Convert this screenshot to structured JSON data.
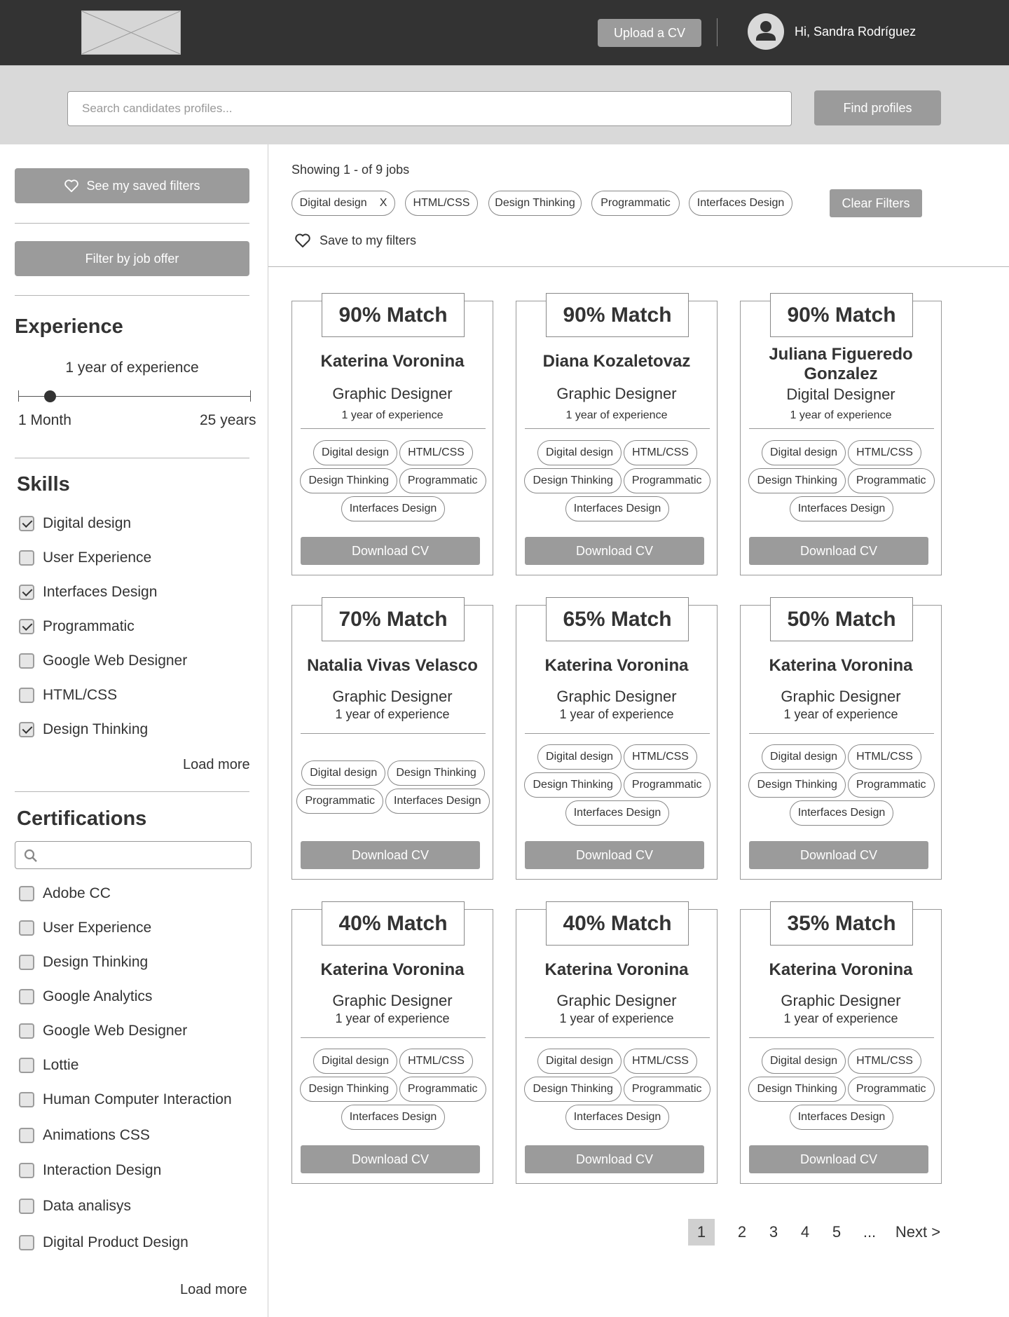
{
  "header": {
    "upload_label": "Upload a CV",
    "greeting": "Hi, Sandra Rodríguez"
  },
  "search": {
    "placeholder": "Search candidates profiles...",
    "button_label": "Find profiles"
  },
  "sidebar": {
    "saved_filters_label": "See my saved filters",
    "filter_by_job_label": "Filter by job offer",
    "experience": {
      "title": "Experience",
      "value_label": "1 year of experience",
      "min_label": "1 Month",
      "max_label": "25 years",
      "slider_value_fraction": 0.13
    },
    "skills": {
      "title": "Skills",
      "items": [
        {
          "label": "Digital design",
          "checked": true
        },
        {
          "label": "User Experience",
          "checked": false
        },
        {
          "label": "Interfaces Design",
          "checked": true
        },
        {
          "label": "Programmatic",
          "checked": true
        },
        {
          "label": "Google Web Designer",
          "checked": false
        },
        {
          "label": "HTML/CSS",
          "checked": false
        },
        {
          "label": "Design Thinking",
          "checked": true
        }
      ],
      "load_more": "Load more"
    },
    "certifications": {
      "title": "Certifications",
      "items": [
        {
          "label": "Adobe CC",
          "checked": false
        },
        {
          "label": "User Experience",
          "checked": false
        },
        {
          "label": "Design Thinking",
          "checked": false
        },
        {
          "label": "Google Analytics",
          "checked": false
        },
        {
          "label": "Google Web Designer",
          "checked": false
        },
        {
          "label": "Lottie",
          "checked": false
        },
        {
          "label": "Human Computer Interaction",
          "checked": false
        },
        {
          "label": "Animations CSS",
          "checked": false
        },
        {
          "label": "Interaction Design",
          "checked": false
        },
        {
          "label": "Data analisys",
          "checked": false
        },
        {
          "label": "Digital Product Design",
          "checked": false
        }
      ],
      "load_more": "Load more"
    }
  },
  "results": {
    "showing": "Showing 1 - of 9 jobs",
    "active_filters": [
      "Digital design",
      "HTML/CSS",
      "Design Thinking",
      "Programmatic",
      "Interfaces Design"
    ],
    "remove_filter_label": "X",
    "clear_filters_label": "Clear Filters",
    "save_filters_label": "Save to my filters"
  },
  "cards": [
    {
      "match": "90% Match",
      "name": "Katerina Voronina",
      "role": "Graphic Designer",
      "experience": "1 year of experience",
      "tags": [
        "Digital design",
        "HTML/CSS",
        "Design Thinking",
        "Programmatic",
        "Interfaces Design"
      ],
      "download": "Download CV"
    },
    {
      "match": "90% Match",
      "name": "Diana Kozaletovaz",
      "role": "Graphic Designer",
      "experience": "1 year of experience",
      "tags": [
        "Digital design",
        "HTML/CSS",
        "Design Thinking",
        "Programmatic",
        "Interfaces Design"
      ],
      "download": "Download CV"
    },
    {
      "match": "90% Match",
      "name": "Juliana Figueredo Gonzalez",
      "role": "Digital Designer",
      "experience": "1 year of experience",
      "tags": [
        "Digital design",
        "HTML/CSS",
        "Design Thinking",
        "Programmatic",
        "Interfaces Design"
      ],
      "download": "Download CV"
    },
    {
      "match": "70% Match",
      "name": "Natalia Vivas Velasco",
      "role": "Graphic Designer",
      "experience": "1 year of experience",
      "tags": [
        "Digital design",
        "Design Thinking",
        "Programmatic",
        "Interfaces Design"
      ],
      "download": "Download CV"
    },
    {
      "match": "65% Match",
      "name": "Katerina Voronina",
      "role": "Graphic Designer",
      "experience": "1 year of experience",
      "tags": [
        "Digital design",
        "HTML/CSS",
        "Design Thinking",
        "Programmatic",
        "Interfaces Design"
      ],
      "download": "Download CV"
    },
    {
      "match": "50% Match",
      "name": "Katerina Voronina",
      "role": "Graphic Designer",
      "experience": "1 year of experience",
      "tags": [
        "Digital design",
        "HTML/CSS",
        "Design Thinking",
        "Programmatic",
        "Interfaces Design"
      ],
      "download": "Download CV"
    },
    {
      "match": "40% Match",
      "name": "Katerina Voronina",
      "role": "Graphic Designer",
      "experience": "1 year of experience",
      "tags": [
        "Digital design",
        "HTML/CSS",
        "Design Thinking",
        "Programmatic",
        "Interfaces Design"
      ],
      "download": "Download CV"
    },
    {
      "match": "40% Match",
      "name": "Katerina Voronina",
      "role": "Graphic Designer",
      "experience": "1 year of experience",
      "tags": [
        "Digital design",
        "HTML/CSS",
        "Design Thinking",
        "Programmatic",
        "Interfaces Design"
      ],
      "download": "Download CV"
    },
    {
      "match": "35% Match",
      "name": "Katerina Voronina",
      "role": "Graphic Designer",
      "experience": "1 year of experience",
      "tags": [
        "Digital design",
        "HTML/CSS",
        "Design Thinking",
        "Programmatic",
        "Interfaces Design"
      ],
      "download": "Download CV"
    }
  ],
  "pagination": {
    "pages": [
      "1",
      "2",
      "3",
      "4",
      "5",
      "..."
    ],
    "current": "1",
    "next_label": "Next >"
  },
  "colors": {
    "header_bg": "#333333",
    "button_gray": "#9b9b9b",
    "band_gray": "#d9d9d9"
  },
  "icons": [
    "logo-placeholder",
    "user-avatar-icon",
    "heart-icon",
    "search-icon",
    "checkbox-check-icon"
  ]
}
